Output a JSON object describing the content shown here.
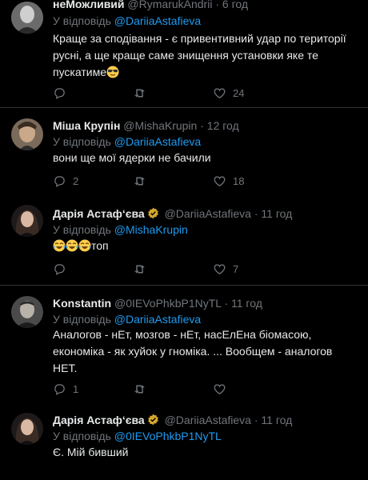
{
  "reply_prefix": "У відповідь",
  "tweets": [
    {
      "name": "неМожливий",
      "handle": "@RymarukAndrii",
      "time": "6 год",
      "reply_to": "@DariiaAstafieva",
      "text_line1": "Краще за сподівання - є привентивний удар по території",
      "text_line2": "русні, а ще краще саме знищення установки яке те",
      "text_line3": "пускатиме",
      "emoji": "sunglasses-face",
      "replies": "",
      "retweets": "",
      "likes": "24",
      "verified": false
    },
    {
      "name": "Міша Крупін",
      "handle": "@MishaKrupin",
      "time": "12 год",
      "reply_to": "@DariiaAstafieva",
      "text_line1": "вони ще мої ядерки не бачили",
      "replies": "2",
      "retweets": "",
      "likes": "18",
      "verified": false
    },
    {
      "name": "Дарія Астаф‘єва",
      "handle": "@DariiaAstafieva",
      "time": "11 год",
      "reply_to": "@MishaKrupin",
      "text_line1": "топ",
      "emoji": "crying-laughing-face x3",
      "replies": "",
      "retweets": "",
      "likes": "7",
      "verified": true
    },
    {
      "name": "Konstantin",
      "handle": "@0IEVoPhkbP1NyTL",
      "time": "11 год",
      "reply_to": "@DariiaAstafieva",
      "text_line1": "Аналогов - нЕт, мозгов - нЕт, насЕлЕна біомасою,",
      "text_line2": "економіка - як  хуйок у гноміка. ... Вообщем - аналогов",
      "text_line3": "НЕТ.",
      "replies": "1",
      "retweets": "",
      "likes": "",
      "verified": false
    },
    {
      "name": "Дарія Астаф‘єва",
      "handle": "@DariiaAstafieva",
      "time": "11 год",
      "reply_to": "@0IEVoPhkbP1NyTL",
      "text_line1": "Є. Мій бивший",
      "verified": true
    }
  ],
  "sep": "·",
  "colors": {
    "background": "#000000",
    "text": "#e7e9ea",
    "muted": "#71767b",
    "accent": "#1d9bf0",
    "verified": "#d4a72c"
  }
}
